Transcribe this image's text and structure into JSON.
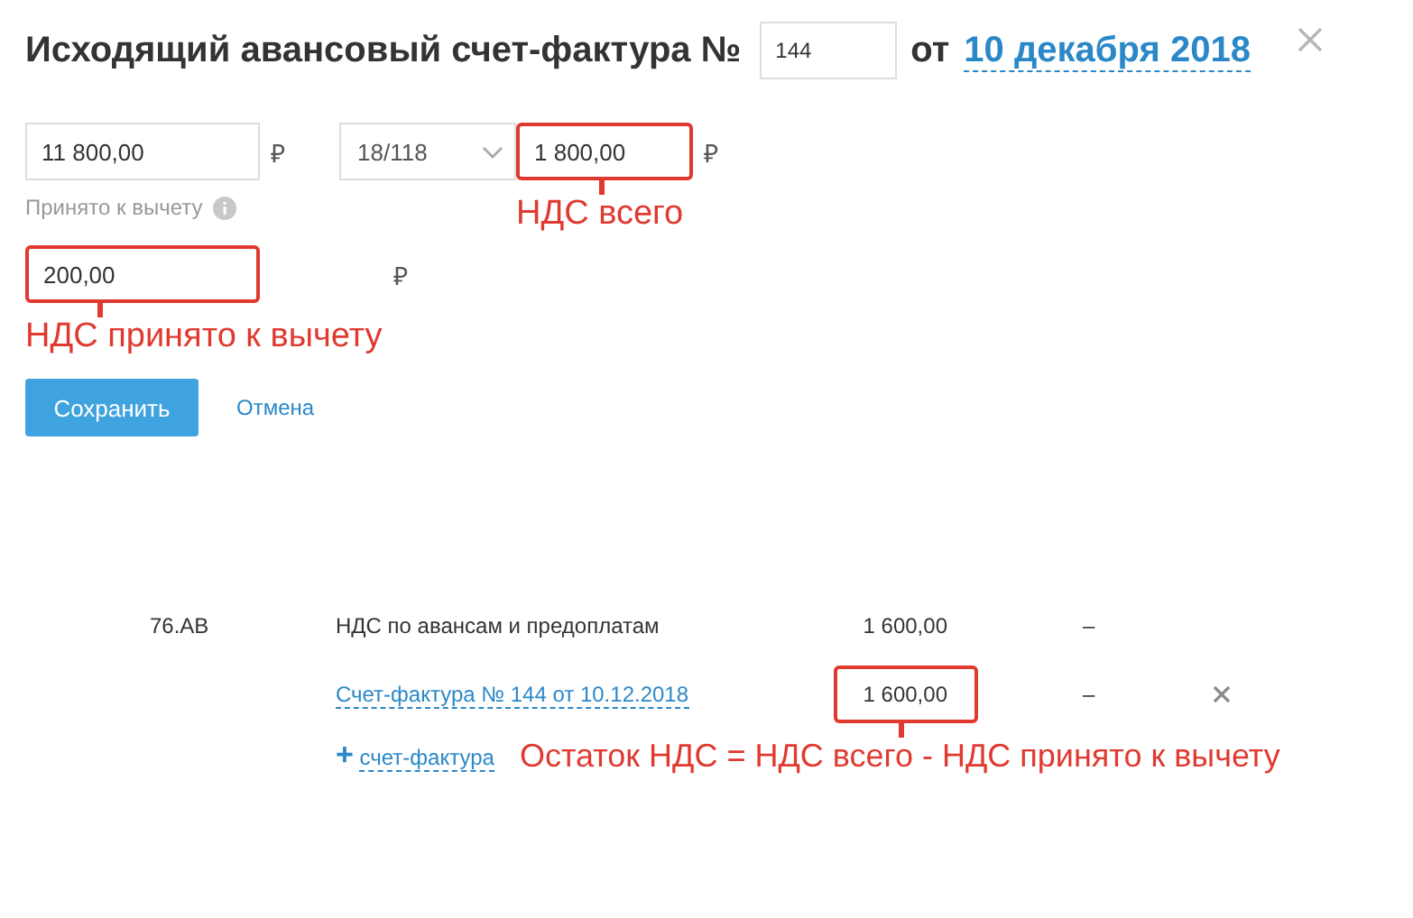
{
  "title": {
    "text": "Исходящий авансовый счет-фактура №",
    "number": "144",
    "of": "от",
    "date": "10 декабря 2018"
  },
  "amounts": {
    "total": "11 800,00",
    "total_currency": "₽",
    "rate": "18/118",
    "vat": "1 800,00",
    "vat_highlighted": true,
    "vat_currency": "₽",
    "vat_note": "НДС всего"
  },
  "deduction": {
    "label": "Принято к вычету",
    "value": "200,00",
    "highlighted": true,
    "currency": "₽",
    "note": "НДС принято к вычету"
  },
  "buttons": {
    "save": "Сохранить",
    "cancel": "Отмена"
  },
  "entries": [
    {
      "kind": "account",
      "account": "76.АВ",
      "name": "НДС по авансам и предоплатам",
      "amount": "1 600,00",
      "highlighted": false,
      "dash": "–"
    },
    {
      "kind": "invoice",
      "name": "Счет-фактура № 144 от 10.12.2018",
      "amount": "1 600,00",
      "highlighted": true,
      "dash": "–",
      "removable": true
    },
    {
      "kind": "add",
      "plus": "+",
      "name": "счет-фактура",
      "note": "Остаток НДС = НДС всего - НДС принято к вычету"
    }
  ]
}
